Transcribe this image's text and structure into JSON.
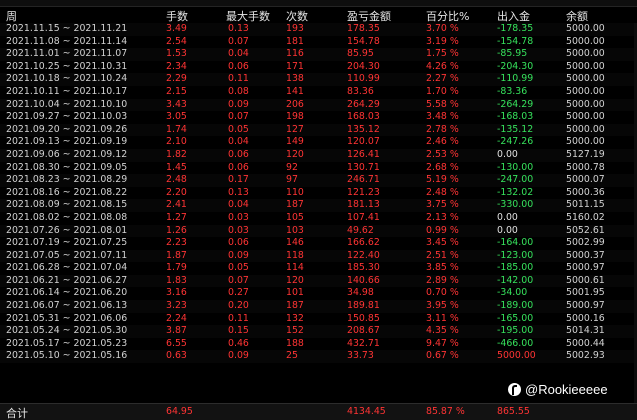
{
  "header": {
    "week": "周",
    "lots": "手数",
    "max_lots": "最大手数",
    "count": "次数",
    "pnl": "盈亏金额",
    "pct": "百分比%",
    "inout": "出入金",
    "balance": "余额"
  },
  "rows": [
    {
      "week": "2021.11.15 ~ 2021.11.21",
      "lots": "3.49",
      "max_lots": "0.13",
      "count": "193",
      "pnl": "178.35",
      "pct": "3.70 %",
      "inout": "-178.35",
      "balance": "5000.00"
    },
    {
      "week": "2021.11.08 ~ 2021.11.14",
      "lots": "2.54",
      "max_lots": "0.07",
      "count": "181",
      "pnl": "154.78",
      "pct": "3.19 %",
      "inout": "-154.78",
      "balance": "5000.00"
    },
    {
      "week": "2021.11.01 ~ 2021.11.07",
      "lots": "1.53",
      "max_lots": "0.04",
      "count": "116",
      "pnl": "85.95",
      "pct": "1.75 %",
      "inout": "-85.95",
      "balance": "5000.00"
    },
    {
      "week": "2021.10.25 ~ 2021.10.31",
      "lots": "2.34",
      "max_lots": "0.06",
      "count": "171",
      "pnl": "204.30",
      "pct": "4.26 %",
      "inout": "-204.30",
      "balance": "5000.00"
    },
    {
      "week": "2021.10.18 ~ 2021.10.24",
      "lots": "2.29",
      "max_lots": "0.11",
      "count": "138",
      "pnl": "110.99",
      "pct": "2.27 %",
      "inout": "-110.99",
      "balance": "5000.00"
    },
    {
      "week": "2021.10.11 ~ 2021.10.17",
      "lots": "2.15",
      "max_lots": "0.08",
      "count": "141",
      "pnl": "83.36",
      "pct": "1.70 %",
      "inout": "-83.36",
      "balance": "5000.00"
    },
    {
      "week": "2021.10.04 ~ 2021.10.10",
      "lots": "3.43",
      "max_lots": "0.09",
      "count": "206",
      "pnl": "264.29",
      "pct": "5.58 %",
      "inout": "-264.29",
      "balance": "5000.00"
    },
    {
      "week": "2021.09.27 ~ 2021.10.03",
      "lots": "3.05",
      "max_lots": "0.07",
      "count": "198",
      "pnl": "168.03",
      "pct": "3.48 %",
      "inout": "-168.03",
      "balance": "5000.00"
    },
    {
      "week": "2021.09.20 ~ 2021.09.26",
      "lots": "1.74",
      "max_lots": "0.05",
      "count": "127",
      "pnl": "135.12",
      "pct": "2.78 %",
      "inout": "-135.12",
      "balance": "5000.00"
    },
    {
      "week": "2021.09.13 ~ 2021.09.19",
      "lots": "2.10",
      "max_lots": "0.04",
      "count": "149",
      "pnl": "120.07",
      "pct": "2.46 %",
      "inout": "-247.26",
      "balance": "5000.00"
    },
    {
      "week": "2021.09.06 ~ 2021.09.12",
      "lots": "1.82",
      "max_lots": "0.06",
      "count": "120",
      "pnl": "126.41",
      "pct": "2.53 %",
      "inout": "0.00",
      "balance": "5127.19"
    },
    {
      "week": "2021.08.30 ~ 2021.09.05",
      "lots": "1.45",
      "max_lots": "0.06",
      "count": "92",
      "pnl": "130.71",
      "pct": "2.68 %",
      "inout": "-130.00",
      "balance": "5000.78"
    },
    {
      "week": "2021.08.23 ~ 2021.08.29",
      "lots": "2.48",
      "max_lots": "0.17",
      "count": "97",
      "pnl": "246.71",
      "pct": "5.19 %",
      "inout": "-247.00",
      "balance": "5000.07"
    },
    {
      "week": "2021.08.16 ~ 2021.08.22",
      "lots": "2.20",
      "max_lots": "0.13",
      "count": "110",
      "pnl": "121.23",
      "pct": "2.48 %",
      "inout": "-132.02",
      "balance": "5000.36"
    },
    {
      "week": "2021.08.09 ~ 2021.08.15",
      "lots": "2.41",
      "max_lots": "0.04",
      "count": "187",
      "pnl": "181.13",
      "pct": "3.75 %",
      "inout": "-330.00",
      "balance": "5011.15"
    },
    {
      "week": "2021.08.02 ~ 2021.08.08",
      "lots": "1.27",
      "max_lots": "0.03",
      "count": "105",
      "pnl": "107.41",
      "pct": "2.13 %",
      "inout": "0.00",
      "balance": "5160.02"
    },
    {
      "week": "2021.07.26 ~ 2021.08.01",
      "lots": "1.26",
      "max_lots": "0.03",
      "count": "103",
      "pnl": "49.62",
      "pct": "0.99 %",
      "inout": "0.00",
      "balance": "5052.61"
    },
    {
      "week": "2021.07.19 ~ 2021.07.25",
      "lots": "2.23",
      "max_lots": "0.06",
      "count": "146",
      "pnl": "166.62",
      "pct": "3.45 %",
      "inout": "-164.00",
      "balance": "5002.99"
    },
    {
      "week": "2021.07.05 ~ 2021.07.11",
      "lots": "1.87",
      "max_lots": "0.09",
      "count": "118",
      "pnl": "122.40",
      "pct": "2.51 %",
      "inout": "-123.00",
      "balance": "5000.37"
    },
    {
      "week": "2021.06.28 ~ 2021.07.04",
      "lots": "1.79",
      "max_lots": "0.05",
      "count": "114",
      "pnl": "185.30",
      "pct": "3.85 %",
      "inout": "-185.00",
      "balance": "5000.97"
    },
    {
      "week": "2021.06.21 ~ 2021.06.27",
      "lots": "1.83",
      "max_lots": "0.07",
      "count": "120",
      "pnl": "140.66",
      "pct": "2.89 %",
      "inout": "-142.00",
      "balance": "5000.61"
    },
    {
      "week": "2021.06.14 ~ 2021.06.20",
      "lots": "3.16",
      "max_lots": "0.27",
      "count": "101",
      "pnl": "34.98",
      "pct": "0.70 %",
      "inout": "-34.00",
      "balance": "5001.95"
    },
    {
      "week": "2021.06.07 ~ 2021.06.13",
      "lots": "3.23",
      "max_lots": "0.20",
      "count": "187",
      "pnl": "189.81",
      "pct": "3.95 %",
      "inout": "-189.00",
      "balance": "5000.97"
    },
    {
      "week": "2021.05.31 ~ 2021.06.06",
      "lots": "2.24",
      "max_lots": "0.11",
      "count": "132",
      "pnl": "150.85",
      "pct": "3.11 %",
      "inout": "-165.00",
      "balance": "5000.16"
    },
    {
      "week": "2021.05.24 ~ 2021.05.30",
      "lots": "3.87",
      "max_lots": "0.15",
      "count": "152",
      "pnl": "208.67",
      "pct": "4.35 %",
      "inout": "-195.00",
      "balance": "5014.31"
    },
    {
      "week": "2021.05.17 ~ 2021.05.23",
      "lots": "6.55",
      "max_lots": "0.46",
      "count": "188",
      "pnl": "432.71",
      "pct": "9.47 %",
      "inout": "-466.00",
      "balance": "5000.44"
    },
    {
      "week": "2021.05.10 ~ 2021.05.16",
      "lots": "0.63",
      "max_lots": "0.09",
      "count": "25",
      "pnl": "33.73",
      "pct": "0.67 %",
      "inout": "5000.00",
      "balance": "5002.93"
    }
  ],
  "total": {
    "label": "合计",
    "lots": "64.95",
    "pnl": "4134.45",
    "pct": "85.87 %",
    "inout": "865.55"
  },
  "watermark": {
    "text": "@Rookieeeee",
    "icon": "pay-logo-icon"
  },
  "colors": {
    "background": "#000000",
    "profit_red": "#ff3434",
    "outflow_green": "#36e25c",
    "text": "#d2d2d2"
  }
}
